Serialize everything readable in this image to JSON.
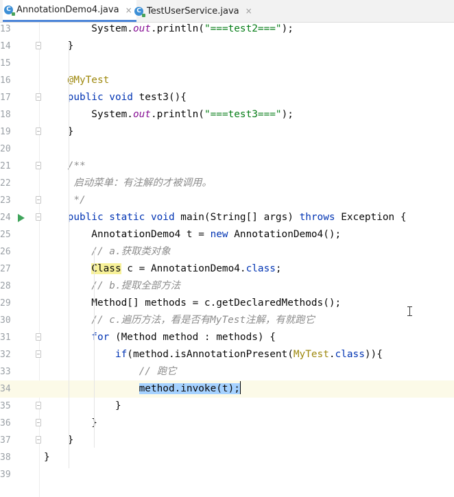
{
  "tabs": [
    {
      "label": "AnnotationDemo4.java",
      "icon": "java-class-icon",
      "close": "×",
      "active": true
    },
    {
      "label": "TestUserService.java",
      "icon": "java-class-icon",
      "close": "×",
      "active": false
    }
  ],
  "code": {
    "lines": [
      {
        "n": "13",
        "t": [
          [
            "",
            "        System."
          ],
          [
            "fld",
            "out"
          ],
          [
            "",
            ".println("
          ],
          [
            "str",
            "\"===test2===\""
          ],
          [
            "",
            ");"
          ]
        ]
      },
      {
        "n": "14",
        "t": [
          [
            "",
            "    }"
          ]
        ]
      },
      {
        "n": "15",
        "t": []
      },
      {
        "n": "16",
        "t": [
          [
            "ann",
            "    @MyTest"
          ]
        ]
      },
      {
        "n": "17",
        "t": [
          [
            "kw",
            "    public void "
          ],
          [
            "",
            "test3(){"
          ]
        ]
      },
      {
        "n": "18",
        "t": [
          [
            "",
            "        System."
          ],
          [
            "fld",
            "out"
          ],
          [
            "",
            ".println("
          ],
          [
            "str",
            "\"===test3===\""
          ],
          [
            "",
            ");"
          ]
        ]
      },
      {
        "n": "19",
        "t": [
          [
            "",
            "    }"
          ]
        ]
      },
      {
        "n": "20",
        "t": []
      },
      {
        "n": "21",
        "t": [
          [
            "cm",
            "    /**"
          ]
        ]
      },
      {
        "n": "22",
        "t": [
          [
            "cm",
            "     启动菜单：有注解的才被调用。"
          ]
        ]
      },
      {
        "n": "23",
        "t": [
          [
            "cm",
            "     */"
          ]
        ]
      },
      {
        "n": "24",
        "t": [
          [
            "kw",
            "    public static void "
          ],
          [
            "",
            "main(String[] args) "
          ],
          [
            "kw",
            "throws "
          ],
          [
            "",
            "Exception {"
          ]
        ]
      },
      {
        "n": "25",
        "t": [
          [
            "",
            "        AnnotationDemo4 t = "
          ],
          [
            "kw",
            "new "
          ],
          [
            "",
            "AnnotationDemo4();"
          ]
        ]
      },
      {
        "n": "26",
        "t": [
          [
            "cm",
            "        // a.获取类对象"
          ]
        ]
      },
      {
        "n": "27",
        "t": [
          [
            "",
            "        "
          ],
          [
            "hl",
            "Class"
          ],
          [
            "",
            " c = AnnotationDemo4."
          ],
          [
            "kw",
            "class"
          ],
          [
            "",
            ";"
          ]
        ]
      },
      {
        "n": "28",
        "t": [
          [
            "cm",
            "        // b.提取全部方法"
          ]
        ]
      },
      {
        "n": "29",
        "t": [
          [
            "",
            "        Method[] methods = c.getDeclaredMethods();"
          ]
        ]
      },
      {
        "n": "30",
        "t": [
          [
            "cm",
            "        // c.遍历方法，看是否有MyTest注解，有就跑它"
          ]
        ]
      },
      {
        "n": "31",
        "t": [
          [
            "kw",
            "        for "
          ],
          [
            "",
            "(Method method : methods) {"
          ]
        ]
      },
      {
        "n": "32",
        "t": [
          [
            "kw",
            "            if"
          ],
          [
            "",
            "(method.isAnnotationPresent("
          ],
          [
            "ann",
            "MyTest"
          ],
          [
            "",
            "."
          ],
          [
            "kw",
            "class"
          ],
          [
            "",
            ")){"
          ]
        ]
      },
      {
        "n": "33",
        "t": [
          [
            "cm",
            "                // 跑它"
          ]
        ]
      },
      {
        "n": "34",
        "t": [
          [
            "",
            "                "
          ],
          [
            "sel",
            "method.invoke(t);"
          ]
        ]
      },
      {
        "n": "35",
        "t": [
          [
            "",
            "            }"
          ]
        ]
      },
      {
        "n": "36",
        "t": [
          [
            "",
            "        }"
          ]
        ]
      },
      {
        "n": "37",
        "t": [
          [
            "",
            "    }"
          ]
        ]
      },
      {
        "n": "38",
        "t": [
          [
            "",
            "}"
          ]
        ]
      },
      {
        "n": "39",
        "t": []
      }
    ],
    "current_line": "34",
    "run_line": "24",
    "fold_lines": [
      "14",
      "17",
      "19",
      "21",
      "23",
      "24",
      "31",
      "32",
      "35",
      "36",
      "37"
    ]
  },
  "colors": {
    "keyword": "#0033b3",
    "annotation": "#9e880d",
    "string": "#067d17",
    "static_field": "#871094",
    "comment": "#8c8c8c",
    "selection": "#a6d2ff",
    "current_line": "#fcfae8"
  }
}
